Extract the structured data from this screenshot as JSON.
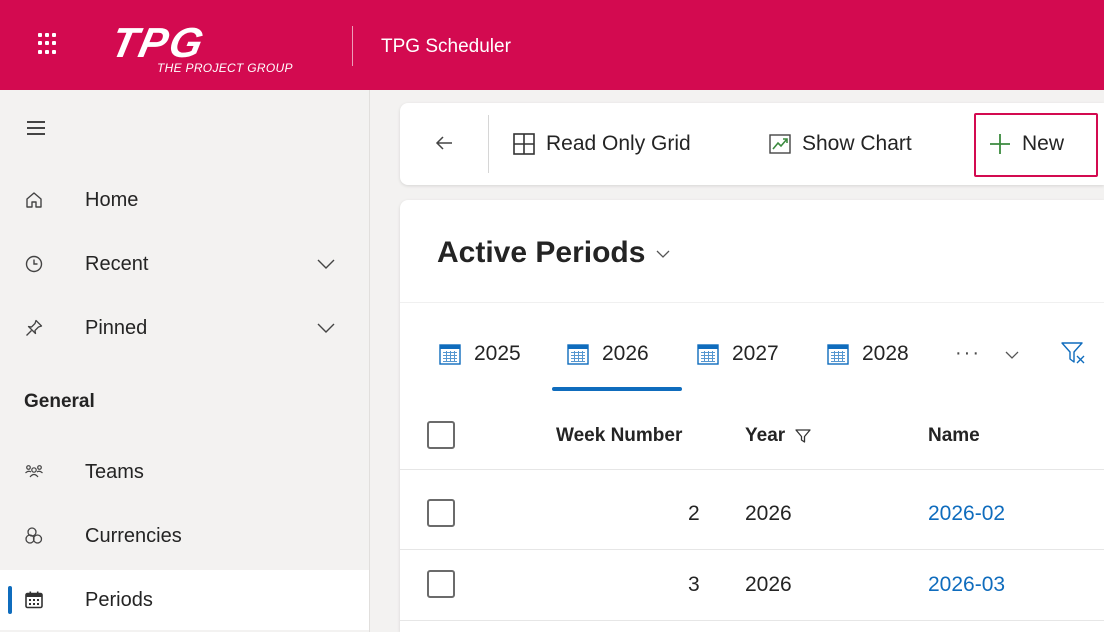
{
  "header": {
    "logo_text": "TPG",
    "logo_subtext": "THE PROJECT GROUP",
    "app_title": "TPG Scheduler",
    "waffle_icon": "app-launcher-icon"
  },
  "sidebar": {
    "collapse_icon": "hamburger-icon",
    "items": [
      {
        "label": "Home",
        "icon": "home-icon"
      },
      {
        "label": "Recent",
        "icon": "clock-icon",
        "expandable": true
      },
      {
        "label": "Pinned",
        "icon": "pin-icon",
        "expandable": true
      }
    ],
    "section_label": "General",
    "section_items": [
      {
        "label": "Teams",
        "icon": "people-icon"
      },
      {
        "label": "Currencies",
        "icon": "coins-icon"
      },
      {
        "label": "Periods",
        "icon": "calendar-icon",
        "selected": true
      }
    ]
  },
  "commandbar": {
    "back_icon": "back-arrow-icon",
    "read_only_grid": "Read Only Grid",
    "show_chart": "Show Chart",
    "new": "New"
  },
  "view": {
    "title": "Active Periods",
    "tabs": [
      {
        "label": "2025",
        "selected": false
      },
      {
        "label": "2026",
        "selected": true
      },
      {
        "label": "2027",
        "selected": false
      },
      {
        "label": "2028",
        "selected": false
      }
    ],
    "more_label": "···",
    "columns": {
      "week_number": "Week Number",
      "year": "Year",
      "name": "Name"
    },
    "rows": [
      {
        "week_number": "2",
        "year": "2026",
        "name": "2026-02"
      },
      {
        "week_number": "3",
        "year": "2026",
        "name": "2026-03"
      }
    ]
  },
  "colors": {
    "brand": "#d30a50",
    "accent": "#0f6cbd",
    "link": "#0f6cbd"
  }
}
